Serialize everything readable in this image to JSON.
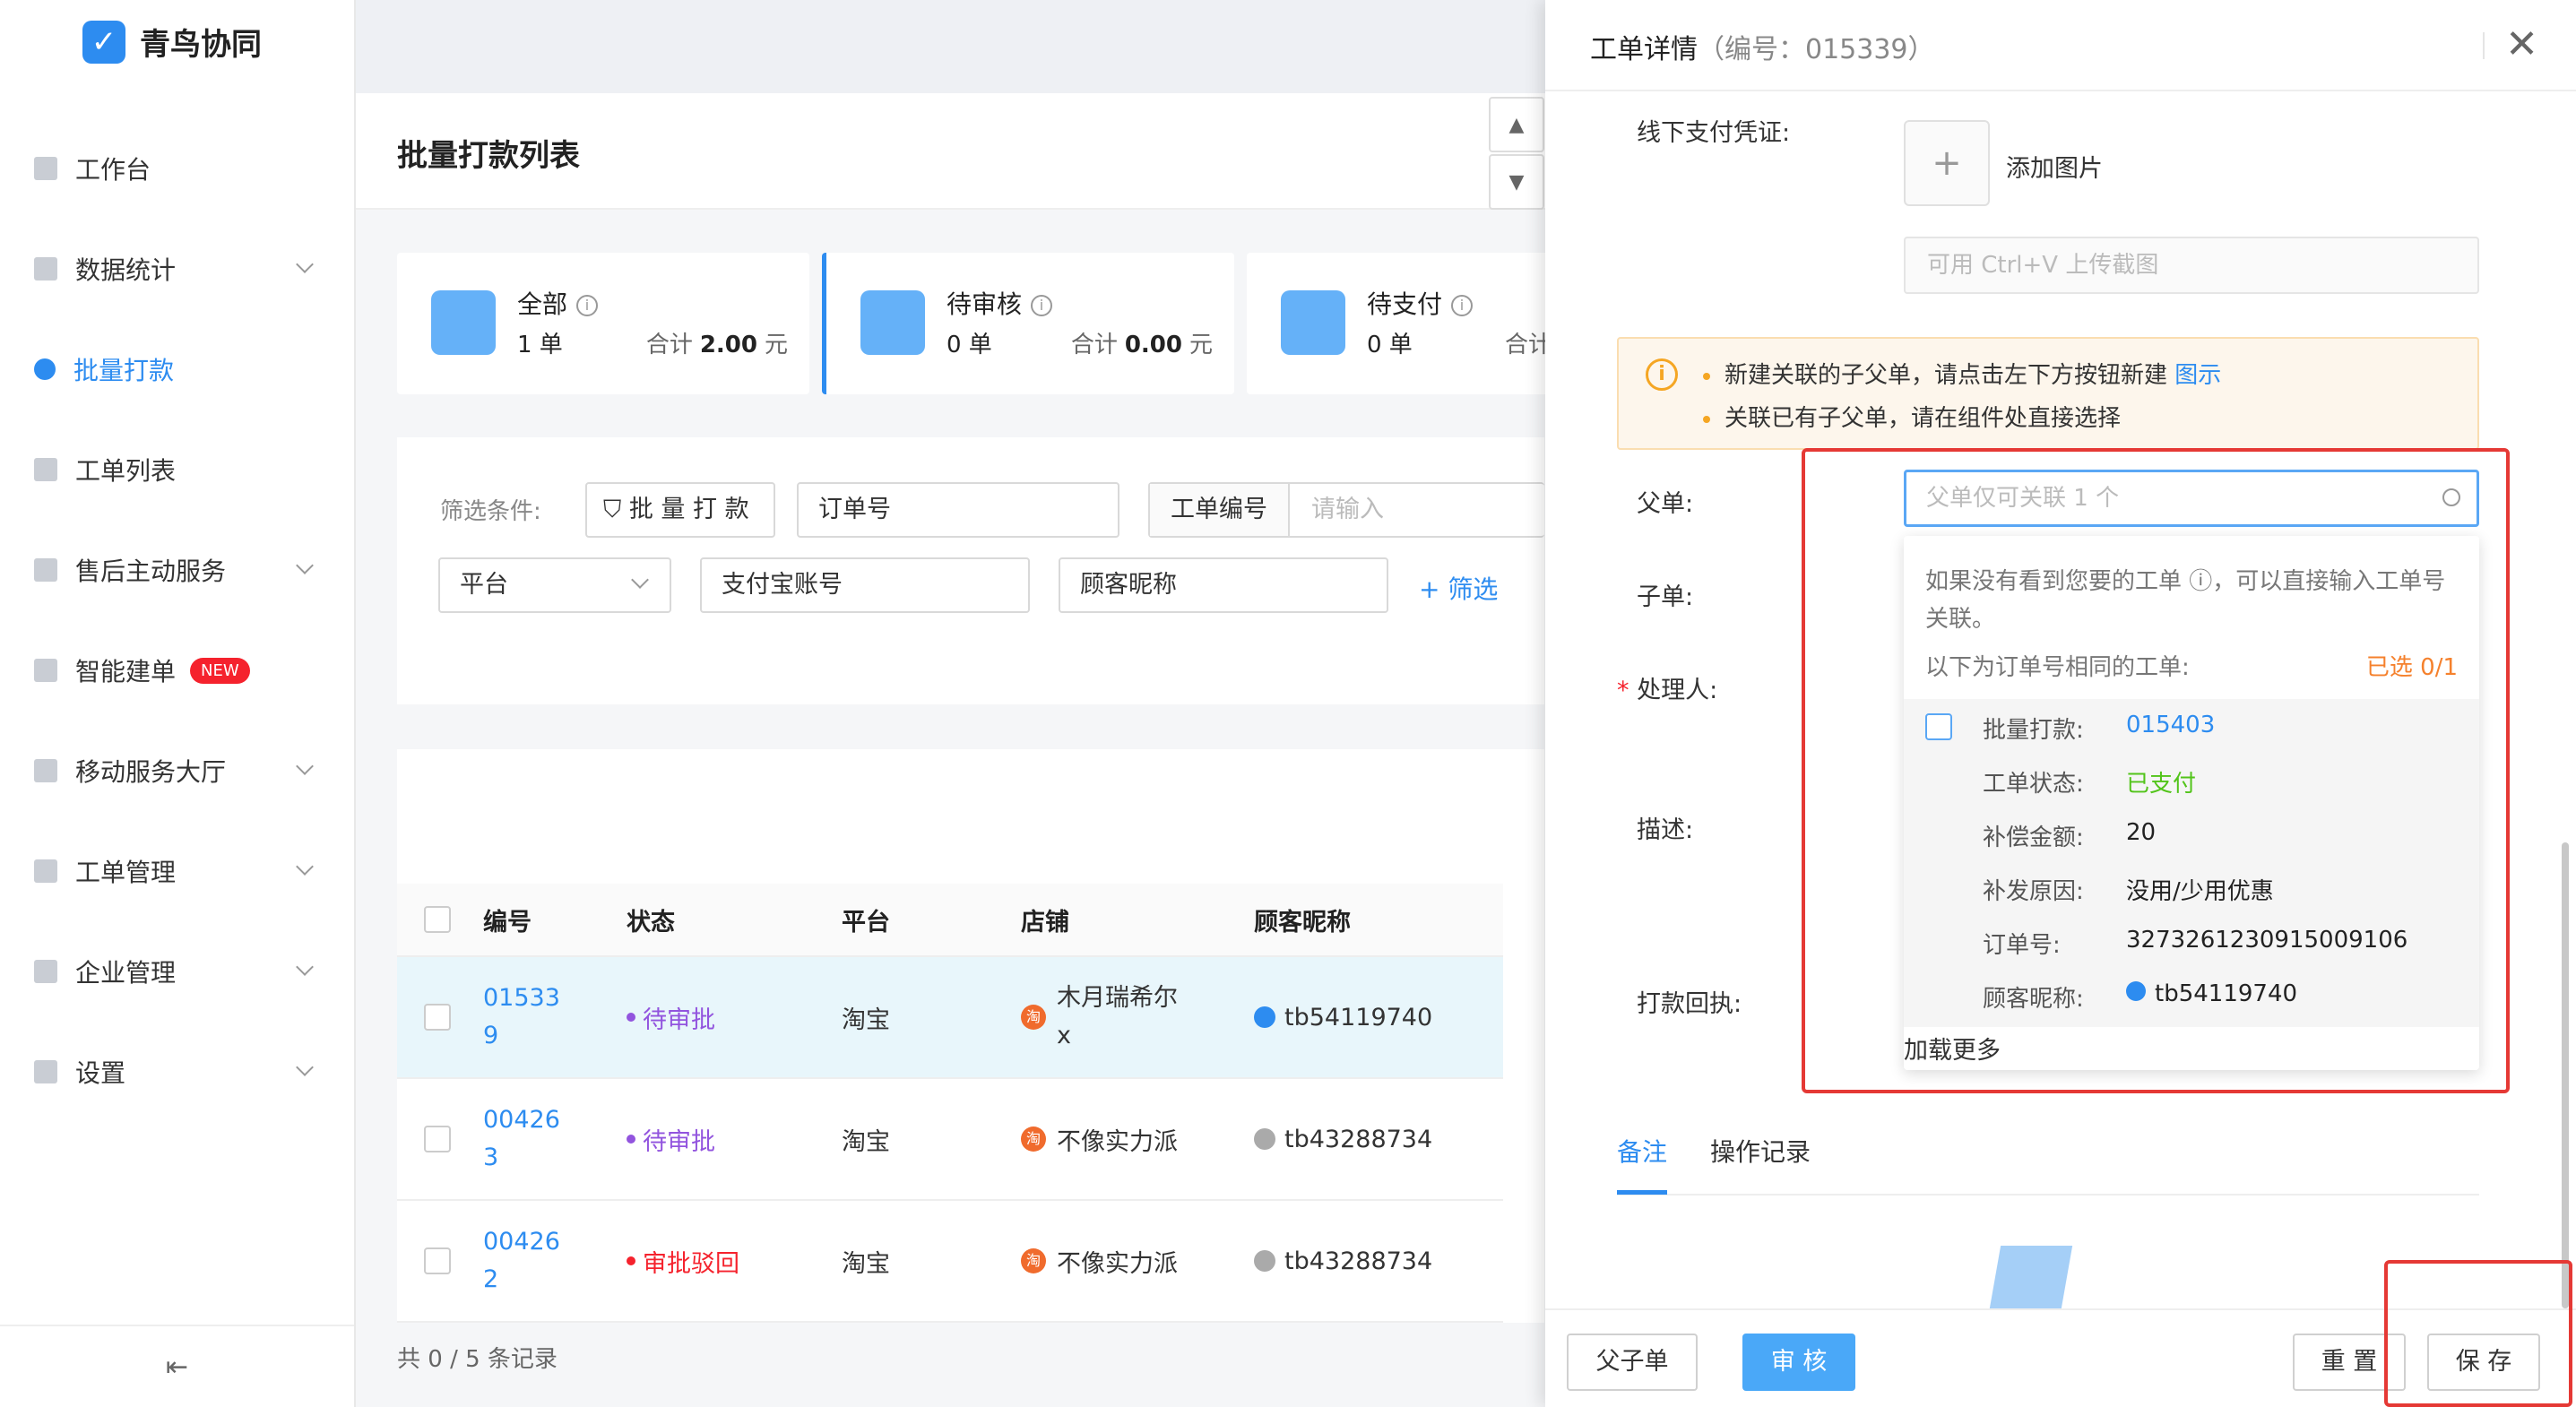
{
  "app": {
    "name": "青鸟协同"
  },
  "sidebar": {
    "items": [
      {
        "label": "工作台"
      },
      {
        "label": "数据统计"
      },
      {
        "label": "批量打款"
      },
      {
        "label": "工单列表"
      },
      {
        "label": "售后主动服务"
      },
      {
        "label": "智能建单",
        "badge": "NEW"
      },
      {
        "label": "移动服务大厅"
      },
      {
        "label": "工单管理"
      },
      {
        "label": "企业管理"
      },
      {
        "label": "设置"
      }
    ],
    "collapse_icon": "collapse-icon"
  },
  "page": {
    "title": "批量打款列表"
  },
  "summary": [
    {
      "label": "全部",
      "count": "1 单",
      "total_label": "合计",
      "total": "2.00",
      "unit": "元"
    },
    {
      "label": "待审核",
      "count": "0 单",
      "total_label": "合计",
      "total": "0.00",
      "unit": "元"
    },
    {
      "label": "待支付",
      "count": "0 单",
      "total_label": "合计"
    }
  ],
  "filter": {
    "label": "筛选条件:",
    "type_button": "批 量 打 款",
    "order_no": "订单号",
    "ticket_no_label": "工单编号",
    "ticket_no_placeholder": "请输入",
    "platform": "平台",
    "alipay": "支付宝账号",
    "nickname": "顾客昵称",
    "add": "+ 筛选"
  },
  "table": {
    "headers": [
      "编号",
      "状态",
      "平台",
      "店铺",
      "顾客昵称"
    ],
    "rows": [
      {
        "id": [
          "01533",
          "9"
        ],
        "status": "待审批",
        "platform": "淘宝",
        "shop": [
          "木月瑞希尔",
          "x"
        ],
        "customer": "tb54119740"
      },
      {
        "id": [
          "00426",
          "3"
        ],
        "status": "待审批",
        "platform": "淘宝",
        "shop": [
          "不像实力派",
          ""
        ],
        "customer": "tb43288734"
      },
      {
        "id": [
          "00426",
          "2"
        ],
        "status": "审批驳回",
        "platform": "淘宝",
        "shop": [
          "不像实力派",
          ""
        ],
        "customer": "tb43288734"
      }
    ],
    "footer": "共 0 / 5 条记录"
  },
  "drawer": {
    "title": "工单详情",
    "code": "（编号：015339）",
    "offline_label": "线下支付凭证:",
    "add_image": "添加图片",
    "paste_placeholder": "可用 Ctrl+V 上传截图",
    "alert_lines": [
      "新建关联的子父单，请点击左下方按钮新建",
      "关联已有子父单，请在组件处直接选择"
    ],
    "alert_link": "图示",
    "parent_label": "父单:",
    "parent_placeholder": "父单仅可关联 1 个",
    "child_label": "子单:",
    "handler_label": "处理人:",
    "desc_label": "描述:",
    "receipt_label": "打款回执:",
    "dropdown": {
      "tip": "如果没有看到您要的工单 ⓘ，可以直接输入工单号关联。",
      "sub": "以下为订单号相同的工单:",
      "count": "已选 0/1",
      "item": [
        {
          "k": "批量打款:",
          "v": "015403"
        },
        {
          "k": "工单状态:",
          "v": "已支付"
        },
        {
          "k": "补偿金额:",
          "v": "20"
        },
        {
          "k": "补发原因:",
          "v": "没用/少用优惠"
        },
        {
          "k": "订单号:",
          "v": "3273261230915009106"
        },
        {
          "k": "顾客昵称:",
          "v": "tb54119740"
        }
      ],
      "more": "加载更多"
    },
    "tabs": [
      "备注",
      "操作记录"
    ],
    "buttons": {
      "parent_child": "父子单",
      "review": "审 核",
      "reset": "重 置",
      "save": "保 存"
    }
  },
  "colors": {
    "accent": "#2d8cf0",
    "warn": "#f5a623",
    "success": "#52c41a",
    "danger": "#f5222d",
    "purple": "#9254de"
  }
}
